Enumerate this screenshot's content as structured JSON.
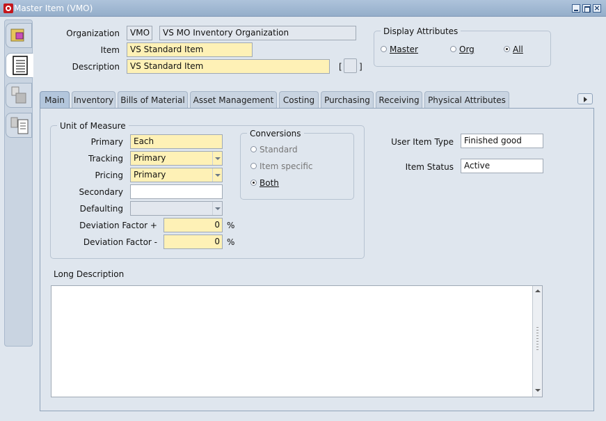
{
  "window": {
    "title": "Master Item (VMO)",
    "logo_icon": "oracle-logo-icon"
  },
  "header": {
    "organization_label": "Organization",
    "organization_code": "VMO",
    "organization_name": "VS MO Inventory Organization",
    "item_label": "Item",
    "item_value": "VS Standard Item",
    "description_label": "Description",
    "description_value": "VS Standard Item",
    "flex_open": "[",
    "flex_close": "]"
  },
  "display_attributes": {
    "title": "Display Attributes",
    "options": [
      "Master",
      "Org",
      "All"
    ],
    "selected": "All"
  },
  "tabs": [
    "Main",
    "Inventory",
    "Bills of Material",
    "Asset Management",
    "Costing",
    "Purchasing",
    "Receiving",
    "Physical Attributes"
  ],
  "active_tab": "Main",
  "uom": {
    "title": "Unit of Measure",
    "primary_label": "Primary",
    "primary_value": "Each",
    "tracking_label": "Tracking",
    "tracking_value": "Primary",
    "pricing_label": "Pricing",
    "pricing_value": "Primary",
    "secondary_label": "Secondary",
    "secondary_value": "",
    "defaulting_label": "Defaulting",
    "defaulting_value": "",
    "dev_plus_label": "Deviation Factor +",
    "dev_plus_value": "0",
    "dev_minus_label": "Deviation Factor -",
    "dev_minus_value": "0",
    "percent": "%"
  },
  "conversions": {
    "title": "Conversions",
    "options": [
      "Standard",
      "Item specific",
      "Both"
    ],
    "selected": "Both"
  },
  "right_fields": {
    "user_item_type_label": "User Item Type",
    "user_item_type_value": "Finished good",
    "item_status_label": "Item Status",
    "item_status_value": "Active"
  },
  "long_description": {
    "label": "Long Description",
    "value": ""
  },
  "colors": {
    "required": "#fef1b6",
    "titlebar": "#94aeca",
    "background": "#dfe6ee"
  }
}
